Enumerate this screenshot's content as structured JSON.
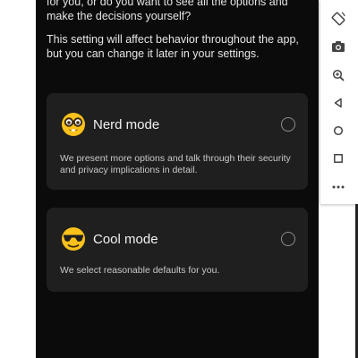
{
  "intro": {
    "line1": "for you, or do you want to see all the options and make the decisions yourself?",
    "line2": "This setting will affect behavior throughout the app, but you can change it later in your settings."
  },
  "options": [
    {
      "title": "Nerd mode",
      "description": "We present more options and talk through their security and privacy implications in detail.",
      "icon": "nerd-face-emoji",
      "selected": false
    },
    {
      "title": "Cool mode",
      "description": "We select reasonable defaults for you.",
      "icon": "sunglasses-face-emoji",
      "selected": false
    }
  ],
  "toolbar": {
    "icons": [
      "rotate-icon",
      "camera-icon",
      "zoom-in-icon",
      "back-icon",
      "home-icon",
      "overview-icon",
      "more-icon"
    ]
  },
  "colors": {
    "background": "#0b0b0b",
    "card": "#1f1f1f",
    "text_primary": "#f2f2f2",
    "text_secondary": "#c9c9c9",
    "emoji_yellow": "#fcc21b"
  }
}
